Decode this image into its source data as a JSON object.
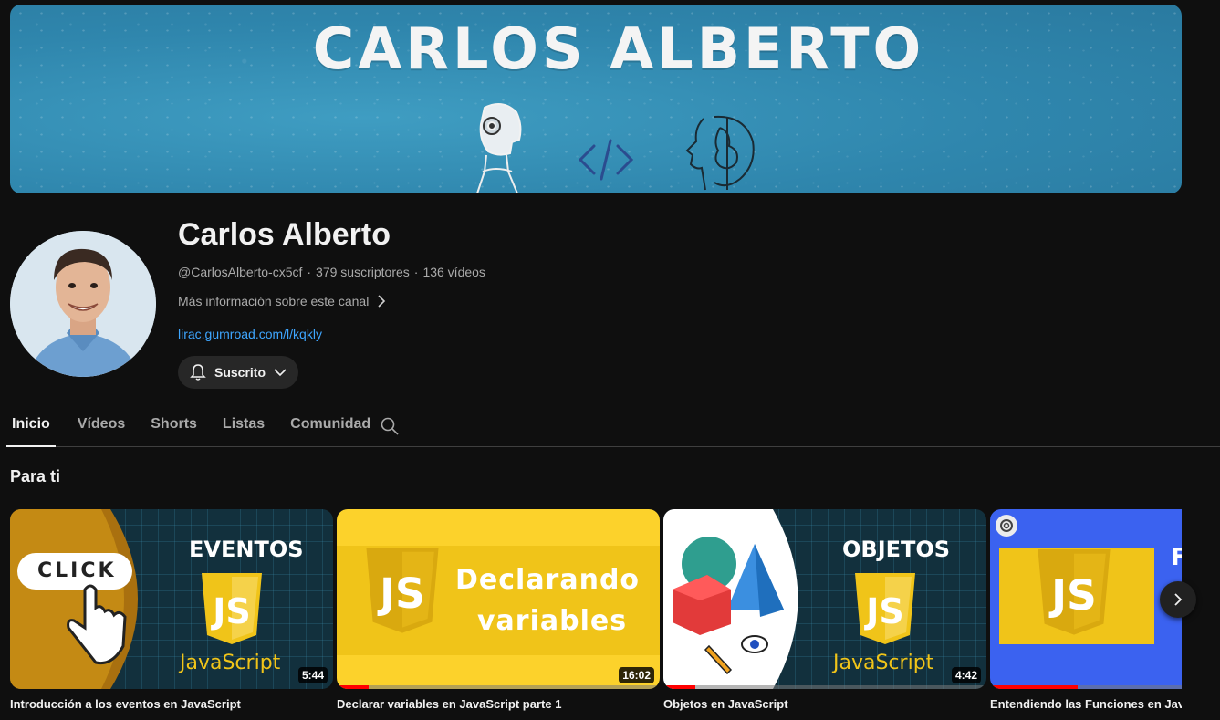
{
  "banner": {
    "title": "CARLOS ALBERTO"
  },
  "channel": {
    "name": "Carlos Alberto",
    "handle": "@CarlosAlberto-cx5cf",
    "subscribers": "379 suscriptores",
    "videos": "136 vídeos",
    "more_info": "Más información sobre este canal",
    "link": "lirac.gumroad.com/l/kqkly",
    "subscribe_label": "Suscrito"
  },
  "tabs": [
    {
      "label": "Inicio",
      "active": true
    },
    {
      "label": "Vídeos",
      "active": false
    },
    {
      "label": "Shorts",
      "active": false
    },
    {
      "label": "Listas",
      "active": false
    },
    {
      "label": "Comunidad",
      "active": false
    }
  ],
  "section": {
    "title": "Para ti"
  },
  "videos": [
    {
      "title": "Introducción a los eventos en JavaScript",
      "duration": "5:44",
      "thumb_heading": "EVENTOS",
      "thumb_badge": "CLICK",
      "thumb_caption": "JavaScript",
      "progress": 0
    },
    {
      "title": "Declarar variables en JavaScript parte 1",
      "duration": "16:02",
      "thumb_line1": "Declarando",
      "thumb_line2": "variables",
      "progress": 0.1
    },
    {
      "title": "Objetos en JavaScript",
      "duration": "4:42",
      "thumb_heading": "OBJETOS",
      "thumb_caption": "JavaScript",
      "progress": 0.1
    },
    {
      "title": "Entendiendo las Funciones en JavaScript",
      "thumb_heading": "F",
      "progress": 0.27
    }
  ],
  "colors": {
    "background": "#0f0f0f",
    "link": "#3ea6ff",
    "js_yellow": "#f0c419",
    "progress_red": "#ff0000"
  }
}
